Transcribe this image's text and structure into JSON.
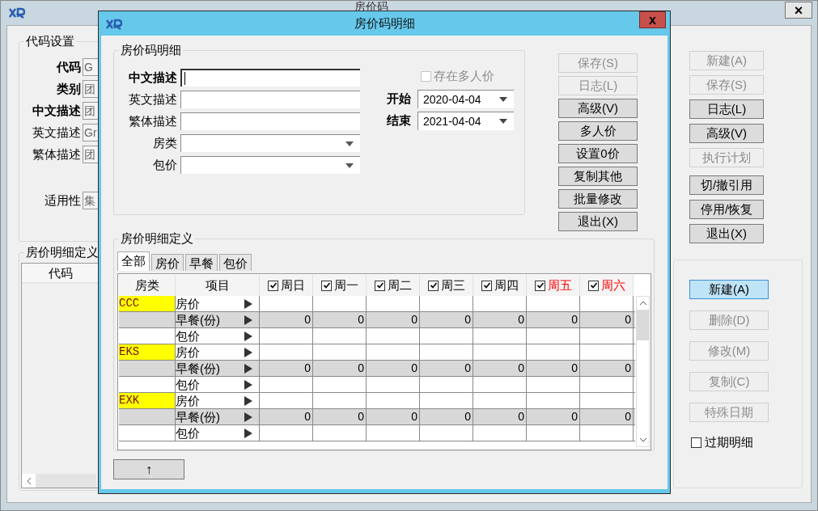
{
  "main_window": {
    "title": "房价码",
    "close": "×",
    "code_group": {
      "title": "代码设置",
      "fields": [
        {
          "label": "代码",
          "value": "G",
          "bold": true
        },
        {
          "label": "类别",
          "value": "团",
          "bold": true
        },
        {
          "label": "中文描述",
          "value": "团",
          "bold": true
        },
        {
          "label": "英文描述",
          "value": "Gr",
          "bold": false
        },
        {
          "label": "繁体描述",
          "value": "团",
          "bold": false
        }
      ],
      "applicability": {
        "label": "适用性",
        "value": "集"
      }
    },
    "detail_group": {
      "title": "房价明细定义",
      "columns": [
        "代码"
      ]
    },
    "top_buttons": [
      {
        "label": "新建(A)",
        "disabled": true
      },
      {
        "label": "保存(S)",
        "disabled": true
      },
      {
        "label": "日志(L)",
        "disabled": false
      },
      {
        "label": "高级(V)",
        "disabled": false
      },
      {
        "label": "执行计划",
        "disabled": true
      },
      {
        "label": "切/撤引用",
        "disabled": false
      },
      {
        "label": "停用/恢复",
        "disabled": false
      },
      {
        "label": "退出(X)",
        "disabled": false
      }
    ],
    "detail_buttons": [
      {
        "label": "新建(A)",
        "disabled": false,
        "highlighted": true
      },
      {
        "label": "删除(D)",
        "disabled": true,
        "highlighted": false
      },
      {
        "label": "修改(M)",
        "disabled": true,
        "highlighted": false
      },
      {
        "label": "复制(C)",
        "disabled": true,
        "highlighted": false
      },
      {
        "label": "特殊日期",
        "disabled": true,
        "highlighted": false
      }
    ],
    "expired_checkbox": {
      "label": "过期明细",
      "checked": false
    }
  },
  "dialog": {
    "title": "房价码明细",
    "close": "x",
    "detail_group": {
      "title": "房价码明细",
      "fields": [
        {
          "label": "中文描述",
          "bold": true,
          "kind": "text",
          "focused": true
        },
        {
          "label": "英文描述",
          "bold": false,
          "kind": "text",
          "focused": false
        },
        {
          "label": "繁体描述",
          "bold": false,
          "kind": "text",
          "focused": false
        },
        {
          "label": "房类",
          "bold": false,
          "kind": "dropdown",
          "focused": false
        },
        {
          "label": "包价",
          "bold": false,
          "kind": "dropdown",
          "focused": false
        }
      ],
      "multi_person": {
        "label": "存在多人价",
        "checked": false,
        "disabled": true
      },
      "dates": [
        {
          "label": "开始",
          "value": "2020-04-04"
        },
        {
          "label": "结束",
          "value": "2021-04-04"
        }
      ]
    },
    "buttons": [
      {
        "label": "保存(S)",
        "disabled": true
      },
      {
        "label": "日志(L)",
        "disabled": true
      },
      {
        "label": "高级(V)",
        "disabled": false
      },
      {
        "label": "多人价",
        "disabled": false
      },
      {
        "label": "设置0价",
        "disabled": false
      },
      {
        "label": "复制其他",
        "disabled": false
      },
      {
        "label": "批量修改",
        "disabled": false
      },
      {
        "label": "退出(X)",
        "disabled": false
      }
    ],
    "definition_group": {
      "title": "房价明细定义",
      "tabs": [
        {
          "label": "全部",
          "selected": true
        },
        {
          "label": "房价",
          "selected": false
        },
        {
          "label": "早餐",
          "selected": false
        },
        {
          "label": "包价",
          "selected": false
        }
      ],
      "columns": [
        "房类",
        "项目"
      ],
      "days": [
        {
          "label": "周日",
          "checked": true,
          "weekend": false
        },
        {
          "label": "周一",
          "checked": true,
          "weekend": false
        },
        {
          "label": "周二",
          "checked": true,
          "weekend": false
        },
        {
          "label": "周三",
          "checked": true,
          "weekend": false
        },
        {
          "label": "周四",
          "checked": true,
          "weekend": false
        },
        {
          "label": "周五",
          "checked": true,
          "weekend": true
        },
        {
          "label": "周六",
          "checked": true,
          "weekend": true
        }
      ],
      "rows": [
        {
          "room_type": "CCC",
          "item": "房价",
          "shaded": false,
          "values": []
        },
        {
          "item": "早餐(份)",
          "shaded": true,
          "values": [
            "0",
            "0",
            "0",
            "0",
            "0",
            "0",
            "0"
          ]
        },
        {
          "item": "包价",
          "shaded": false,
          "values": []
        },
        {
          "room_type": "EKS",
          "item": "房价",
          "shaded": false,
          "values": []
        },
        {
          "item": "早餐(份)",
          "shaded": true,
          "values": [
            "0",
            "0",
            "0",
            "0",
            "0",
            "0",
            "0"
          ]
        },
        {
          "item": "包价",
          "shaded": false,
          "values": []
        },
        {
          "room_type": "EXK",
          "item": "房价",
          "shaded": false,
          "values": []
        },
        {
          "item": "早餐(份)",
          "shaded": true,
          "values": [
            "0",
            "0",
            "0",
            "0",
            "0",
            "0",
            "0"
          ]
        },
        {
          "item": "包价",
          "shaded": false,
          "values": []
        }
      ]
    },
    "up_button": "↑"
  }
}
